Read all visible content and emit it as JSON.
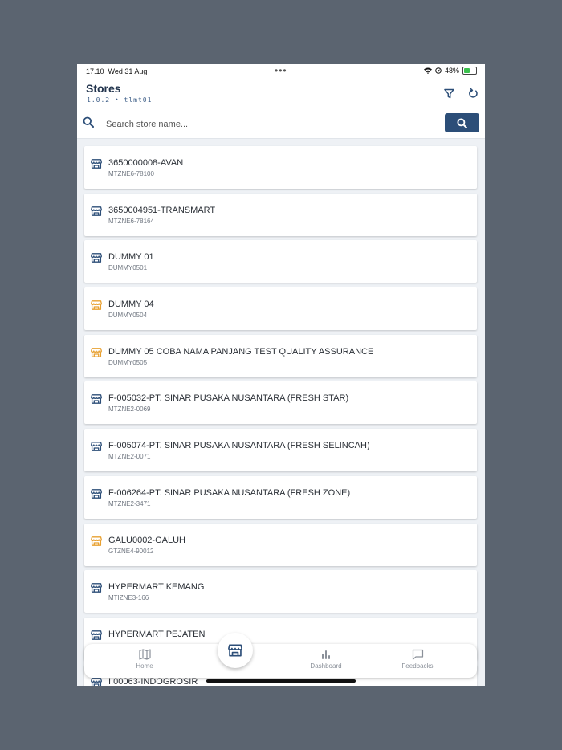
{
  "status_bar": {
    "time": "17.10",
    "date": "Wed 31 Aug",
    "dots": "•••",
    "battery": "48%",
    "battery_level": 0.48
  },
  "header": {
    "title": "Stores",
    "subtitle": "1.0.2 • tlmt01"
  },
  "search": {
    "placeholder": "Search store name..."
  },
  "colors": {
    "primary": "#2c4e78",
    "active_icon": "#2c4e78",
    "pending_icon": "#e8a030",
    "text_dark": "#2a2f36"
  },
  "stores": [
    {
      "name": "3650000008-AVAN",
      "code": "MTZNE6-78100",
      "icon_color": "#2c4e78"
    },
    {
      "name": "3650004951-TRANSMART",
      "code": "MTZNE6-78164",
      "icon_color": "#2c4e78"
    },
    {
      "name": "DUMMY 01",
      "code": "DUMMY0501",
      "icon_color": "#2c4e78"
    },
    {
      "name": "DUMMY 04",
      "code": "DUMMY0504",
      "icon_color": "#e8a030"
    },
    {
      "name": "DUMMY 05 COBA NAMA PANJANG TEST QUALITY ASSURANCE",
      "code": "DUMMY0505",
      "icon_color": "#e8a030"
    },
    {
      "name": "F-005032-PT. SINAR PUSAKA NUSANTARA (FRESH STAR)",
      "code": "MTZNE2-0069",
      "icon_color": "#2c4e78"
    },
    {
      "name": "F-005074-PT. SINAR PUSAKA NUSANTARA (FRESH SELINCAH)",
      "code": "MTZNE2-0071",
      "icon_color": "#2c4e78"
    },
    {
      "name": "F-006264-PT. SINAR PUSAKA NUSANTARA (FRESH ZONE)",
      "code": "MTZNE2-3471",
      "icon_color": "#2c4e78"
    },
    {
      "name": "GALU0002-GALUH",
      "code": "GTZNE4-90012",
      "icon_color": "#e8a030"
    },
    {
      "name": "HYPERMART KEMANG",
      "code": "MTIZNE3-166",
      "icon_color": "#2c4e78"
    },
    {
      "name": "HYPERMART PEJATEN",
      "code": "",
      "icon_color": "#2c4e78"
    },
    {
      "name": "I.00063-INDOGROSIR",
      "code": "",
      "icon_color": "#2c4e78"
    }
  ],
  "bottom_nav": {
    "home": "Home",
    "dashboard": "Dashboard",
    "feedbacks": "Feedbacks"
  }
}
